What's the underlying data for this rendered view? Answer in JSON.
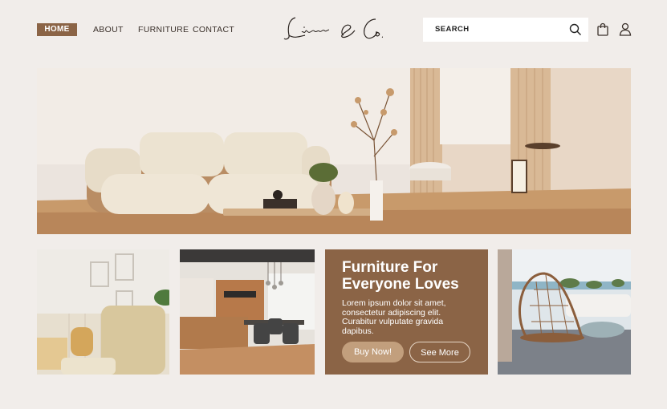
{
  "nav": {
    "home": "HOME",
    "about": "ABOUT",
    "furniture": "FURNITURE",
    "contact": "CONTACT"
  },
  "brand": {
    "logo_text": "Licenia & Co."
  },
  "search": {
    "placeholder": "SEARCH"
  },
  "icons": {
    "search": "search-icon",
    "bag": "shopping-bag-icon",
    "account": "user-icon"
  },
  "promo": {
    "title": "Furniture For Everyone Loves",
    "body": "Lorem ipsum dolor sit amet, consectetur adipiscing elit. Curabitur vulputate gravida dapibus.",
    "buy_label": "Buy Now!",
    "more_label": "See More"
  },
  "colors": {
    "background": "#f1edea",
    "accent": "#8b6446",
    "button": "#c29f7d"
  }
}
